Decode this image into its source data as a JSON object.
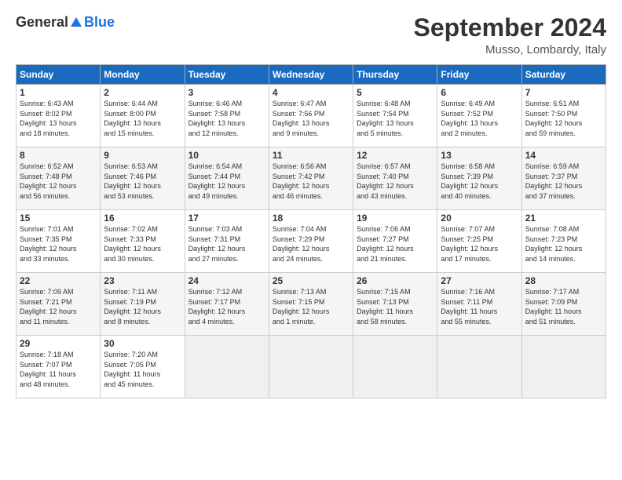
{
  "logo": {
    "general": "General",
    "blue": "Blue"
  },
  "header": {
    "title": "September 2024",
    "location": "Musso, Lombardy, Italy"
  },
  "weekdays": [
    "Sunday",
    "Monday",
    "Tuesday",
    "Wednesday",
    "Thursday",
    "Friday",
    "Saturday"
  ],
  "weeks": [
    [
      {
        "day": "1",
        "info": "Sunrise: 6:43 AM\nSunset: 8:02 PM\nDaylight: 13 hours\nand 18 minutes."
      },
      {
        "day": "2",
        "info": "Sunrise: 6:44 AM\nSunset: 8:00 PM\nDaylight: 13 hours\nand 15 minutes."
      },
      {
        "day": "3",
        "info": "Sunrise: 6:46 AM\nSunset: 7:58 PM\nDaylight: 13 hours\nand 12 minutes."
      },
      {
        "day": "4",
        "info": "Sunrise: 6:47 AM\nSunset: 7:56 PM\nDaylight: 13 hours\nand 9 minutes."
      },
      {
        "day": "5",
        "info": "Sunrise: 6:48 AM\nSunset: 7:54 PM\nDaylight: 13 hours\nand 5 minutes."
      },
      {
        "day": "6",
        "info": "Sunrise: 6:49 AM\nSunset: 7:52 PM\nDaylight: 13 hours\nand 2 minutes."
      },
      {
        "day": "7",
        "info": "Sunrise: 6:51 AM\nSunset: 7:50 PM\nDaylight: 12 hours\nand 59 minutes."
      }
    ],
    [
      {
        "day": "8",
        "info": "Sunrise: 6:52 AM\nSunset: 7:48 PM\nDaylight: 12 hours\nand 56 minutes."
      },
      {
        "day": "9",
        "info": "Sunrise: 6:53 AM\nSunset: 7:46 PM\nDaylight: 12 hours\nand 53 minutes."
      },
      {
        "day": "10",
        "info": "Sunrise: 6:54 AM\nSunset: 7:44 PM\nDaylight: 12 hours\nand 49 minutes."
      },
      {
        "day": "11",
        "info": "Sunrise: 6:56 AM\nSunset: 7:42 PM\nDaylight: 12 hours\nand 46 minutes."
      },
      {
        "day": "12",
        "info": "Sunrise: 6:57 AM\nSunset: 7:40 PM\nDaylight: 12 hours\nand 43 minutes."
      },
      {
        "day": "13",
        "info": "Sunrise: 6:58 AM\nSunset: 7:39 PM\nDaylight: 12 hours\nand 40 minutes."
      },
      {
        "day": "14",
        "info": "Sunrise: 6:59 AM\nSunset: 7:37 PM\nDaylight: 12 hours\nand 37 minutes."
      }
    ],
    [
      {
        "day": "15",
        "info": "Sunrise: 7:01 AM\nSunset: 7:35 PM\nDaylight: 12 hours\nand 33 minutes."
      },
      {
        "day": "16",
        "info": "Sunrise: 7:02 AM\nSunset: 7:33 PM\nDaylight: 12 hours\nand 30 minutes."
      },
      {
        "day": "17",
        "info": "Sunrise: 7:03 AM\nSunset: 7:31 PM\nDaylight: 12 hours\nand 27 minutes."
      },
      {
        "day": "18",
        "info": "Sunrise: 7:04 AM\nSunset: 7:29 PM\nDaylight: 12 hours\nand 24 minutes."
      },
      {
        "day": "19",
        "info": "Sunrise: 7:06 AM\nSunset: 7:27 PM\nDaylight: 12 hours\nand 21 minutes."
      },
      {
        "day": "20",
        "info": "Sunrise: 7:07 AM\nSunset: 7:25 PM\nDaylight: 12 hours\nand 17 minutes."
      },
      {
        "day": "21",
        "info": "Sunrise: 7:08 AM\nSunset: 7:23 PM\nDaylight: 12 hours\nand 14 minutes."
      }
    ],
    [
      {
        "day": "22",
        "info": "Sunrise: 7:09 AM\nSunset: 7:21 PM\nDaylight: 12 hours\nand 11 minutes."
      },
      {
        "day": "23",
        "info": "Sunrise: 7:11 AM\nSunset: 7:19 PM\nDaylight: 12 hours\nand 8 minutes."
      },
      {
        "day": "24",
        "info": "Sunrise: 7:12 AM\nSunset: 7:17 PM\nDaylight: 12 hours\nand 4 minutes."
      },
      {
        "day": "25",
        "info": "Sunrise: 7:13 AM\nSunset: 7:15 PM\nDaylight: 12 hours\nand 1 minute."
      },
      {
        "day": "26",
        "info": "Sunrise: 7:15 AM\nSunset: 7:13 PM\nDaylight: 11 hours\nand 58 minutes."
      },
      {
        "day": "27",
        "info": "Sunrise: 7:16 AM\nSunset: 7:11 PM\nDaylight: 11 hours\nand 55 minutes."
      },
      {
        "day": "28",
        "info": "Sunrise: 7:17 AM\nSunset: 7:09 PM\nDaylight: 11 hours\nand 51 minutes."
      }
    ],
    [
      {
        "day": "29",
        "info": "Sunrise: 7:18 AM\nSunset: 7:07 PM\nDaylight: 11 hours\nand 48 minutes."
      },
      {
        "day": "30",
        "info": "Sunrise: 7:20 AM\nSunset: 7:05 PM\nDaylight: 11 hours\nand 45 minutes."
      },
      {
        "day": "",
        "info": ""
      },
      {
        "day": "",
        "info": ""
      },
      {
        "day": "",
        "info": ""
      },
      {
        "day": "",
        "info": ""
      },
      {
        "day": "",
        "info": ""
      }
    ]
  ]
}
